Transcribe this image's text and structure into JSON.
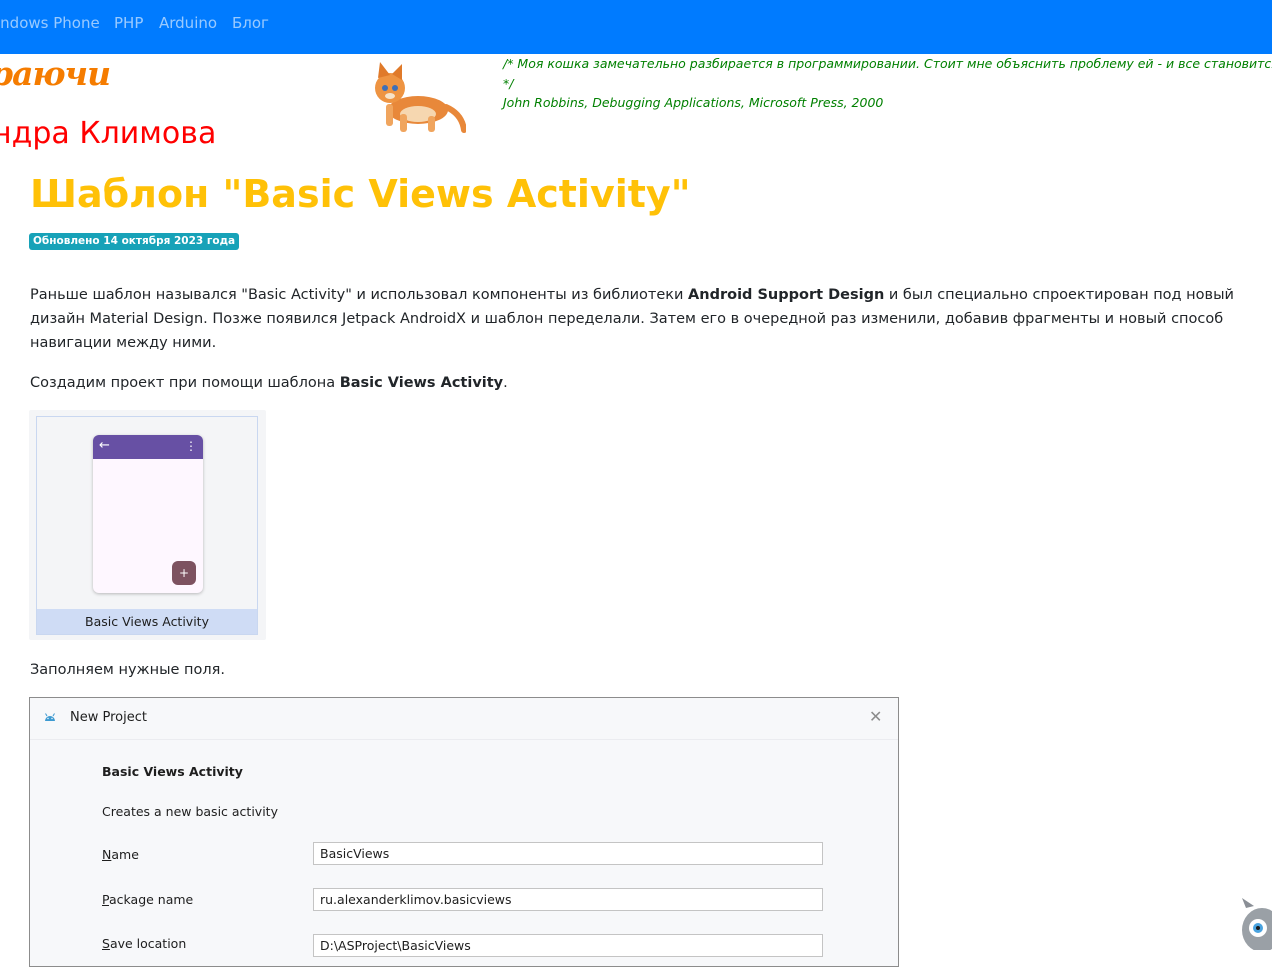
{
  "navbar": {
    "links": [
      "indows Phone",
      "PHP",
      "Arduino",
      "Блог"
    ]
  },
  "header": {
    "site_title": "раючи",
    "author": "ндра Климова",
    "quote_line1": "/* Моя кошка замечательно разбирается в программировании. Стоит мне объяснить проблему ей - и все становится ясно.",
    "quote_line2": "*/",
    "quote_source": "John Robbins, Debugging Applications, Microsoft Press, 2000"
  },
  "article": {
    "title": "Шаблон \"Basic Views Activity\"",
    "updated": "Обновлено 14 октября 2023 года",
    "intro_part1": "Раньше шаблон назывался \"Basic Activity\" и использовал компоненты из библиотеки ",
    "intro_bold": "Android Support Design",
    "intro_part2": " и был специально спроектирован под новый дизайн Material Design. Позже появился Jetpack AndroidX и шаблон переделали. Затем его в очередной раз изменили, добавив фрагменты и новый способ навигации между ними.",
    "create_part1": "Создадим проект при помощи шаблона ",
    "create_bold": "Basic Views Activity",
    "create_part2": ".",
    "fill_fields": "Заполняем нужные поля."
  },
  "template_card": {
    "label": "Basic Views Activity",
    "fab_symbol": "+",
    "back_symbol": "←",
    "menu_symbol": "⋮"
  },
  "dialog": {
    "title": "New Project",
    "close_symbol": "✕",
    "template_name": "Basic Views Activity",
    "description": "Creates a new basic activity",
    "fields": [
      {
        "label_mnemonic": "N",
        "label_rest": "ame",
        "value": "BasicViews"
      },
      {
        "label_mnemonic": "P",
        "label_rest": "ackage name",
        "value": "ru.alexanderklimov.basicviews"
      },
      {
        "label_mnemonic": "S",
        "label_rest": "ave location",
        "value": "D:\\ASProject\\BasicViews"
      }
    ]
  },
  "colors": {
    "navbar": "#007bff",
    "site_title": "#f57c00",
    "author": "#ff0000",
    "quote": "#008000",
    "page_title": "#ffc107",
    "badge": "#17a2b8"
  },
  "icons": [
    "cat-image",
    "android-icon",
    "close-icon",
    "folder-icon",
    "mascot-icon"
  ]
}
